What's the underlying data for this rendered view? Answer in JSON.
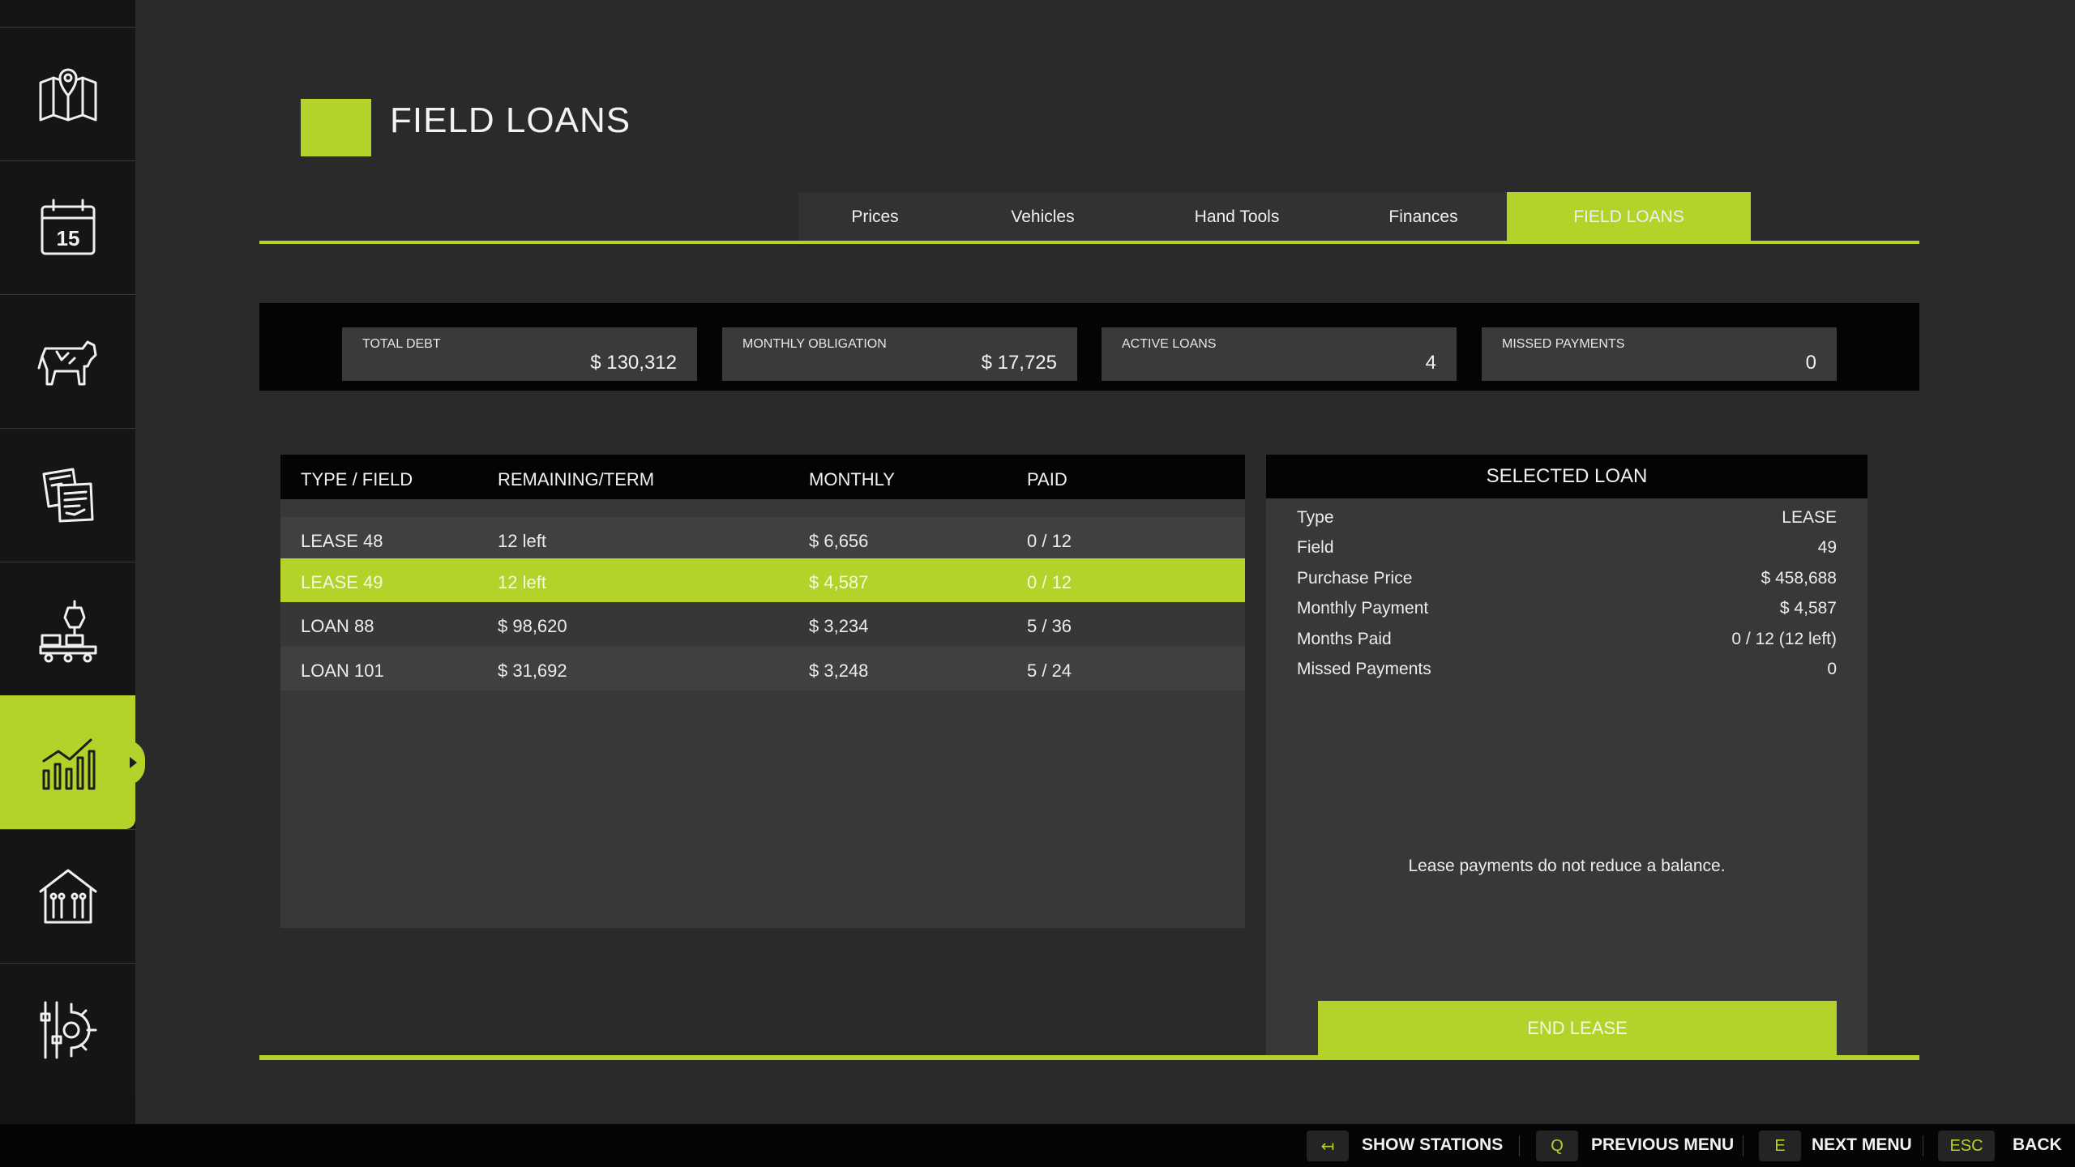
{
  "header": {
    "title": "FIELD LOANS"
  },
  "sidebar": {
    "items": [
      {
        "icon": "map-icon"
      },
      {
        "icon": "calendar-icon",
        "day": "15"
      },
      {
        "icon": "cow-icon"
      },
      {
        "icon": "documents-icon"
      },
      {
        "icon": "production-icon"
      },
      {
        "icon": "finance-chart-icon",
        "active": true
      },
      {
        "icon": "barn-icon"
      },
      {
        "icon": "settings-icon"
      }
    ]
  },
  "tabs": [
    {
      "label": "Prices"
    },
    {
      "label": "Vehicles"
    },
    {
      "label": "Hand Tools"
    },
    {
      "label": "Finances"
    },
    {
      "label": "FIELD LOANS",
      "active": true
    }
  ],
  "stats": [
    {
      "label": "TOTAL DEBT",
      "value": "$ 130,312"
    },
    {
      "label": "MONTHLY OBLIGATION",
      "value": "$ 17,725"
    },
    {
      "label": "ACTIVE LOANS",
      "value": "4"
    },
    {
      "label": "MISSED PAYMENTS",
      "value": "0"
    }
  ],
  "table": {
    "columns": [
      "TYPE / FIELD",
      "REMAINING/TERM",
      "MONTHLY",
      "PAID"
    ],
    "rows": [
      {
        "type": "LEASE 48",
        "remaining": "12 left",
        "monthly": "$ 6,656",
        "paid": "0 / 12"
      },
      {
        "type": "LEASE 49",
        "remaining": "12 left",
        "monthly": "$ 4,587",
        "paid": "0 / 12",
        "selected": true
      },
      {
        "type": "LOAN 88",
        "remaining": "$ 98,620",
        "monthly": "$ 3,234",
        "paid": "5 / 36"
      },
      {
        "type": "LOAN 101",
        "remaining": "$ 31,692",
        "monthly": "$ 3,248",
        "paid": "5 / 24"
      }
    ]
  },
  "selected_loan": {
    "title": "SELECTED LOAN",
    "fields": [
      {
        "key": "Type",
        "value": "LEASE"
      },
      {
        "key": "Field",
        "value": "49"
      },
      {
        "key": "Purchase Price",
        "value": "$ 458,688"
      },
      {
        "key": "Monthly Payment",
        "value": "$ 4,587"
      },
      {
        "key": "Months Paid",
        "value": "0 / 12 (12 left)"
      },
      {
        "key": "Missed Payments",
        "value": "0"
      }
    ],
    "note": "Lease payments do not reduce a balance.",
    "button_label": "END LEASE"
  },
  "footer": {
    "actions": [
      {
        "key": "↤",
        "label": "SHOW STATIONS"
      },
      {
        "key": "Q",
        "label": "PREVIOUS MENU"
      },
      {
        "key": "E",
        "label": "NEXT MENU"
      },
      {
        "key": "ESC",
        "label": "BACK"
      }
    ]
  },
  "colors": {
    "accent": "#b3d32a",
    "background": "#2a2a2a",
    "panel": "#383838",
    "header": "#040404"
  }
}
